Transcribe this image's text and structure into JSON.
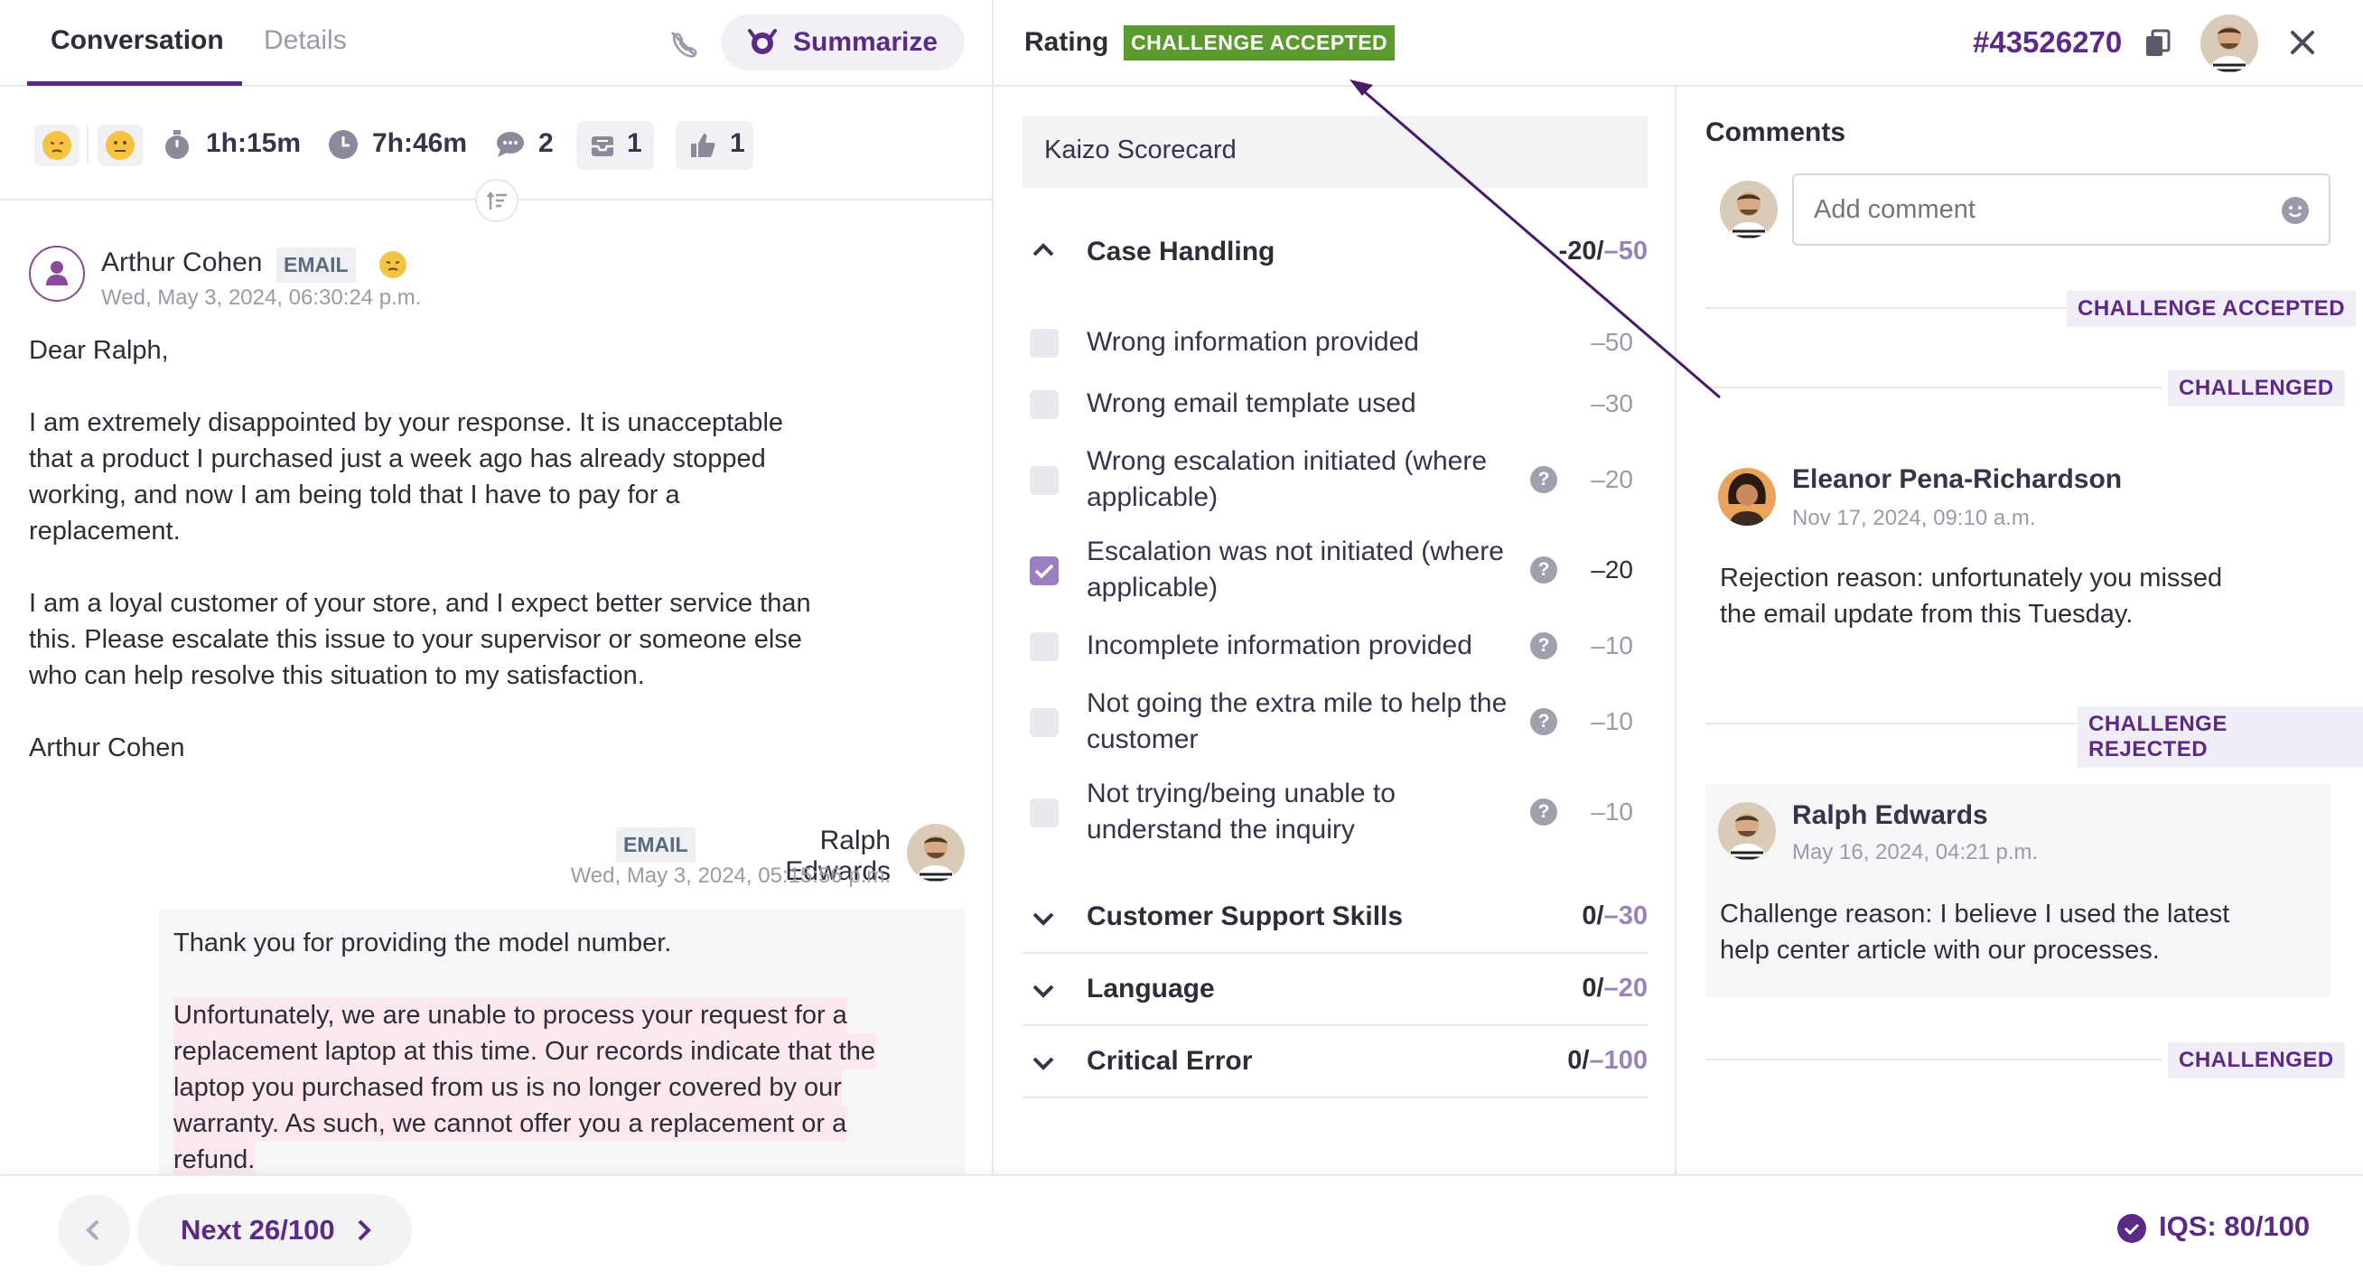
{
  "conversation": {
    "tabs": {
      "conversation": "Conversation",
      "details": "Details"
    },
    "summarize_label": "Summarize",
    "stats": {
      "handle_time": "1h:15m",
      "total_time": "7h:46m",
      "comments": "2",
      "tickets": "1",
      "likes": "1"
    },
    "message1": {
      "author": "Arthur Cohen",
      "channel": "EMAIL",
      "time": "Wed, May 3, 2024, 06:30:24 p.m.",
      "lines": [
        "Dear Ralph,",
        "I am extremely disappointed by your response. It is unacceptable",
        "that a product I purchased just a week ago has already stopped",
        "working, and now I am being told that I have to pay for a",
        "replacement.",
        "I am a loyal customer of your store, and I expect better service than",
        "this. Please escalate this issue to your supervisor or someone else",
        "who can help resolve this situation to my satisfaction.",
        "Arthur Cohen"
      ]
    },
    "message2": {
      "author": "Ralph Edwards",
      "channel": "EMAIL",
      "time": "Wed, May 3, 2024, 05:15:56 p.m.",
      "line1": "Thank you for providing the model number.",
      "highlight": [
        "Unfortunately, we are unable to process your request for a",
        "replacement laptop at this time. Our records indicate that the",
        "laptop you purchased from us is no longer covered by our",
        "warranty. As such, we cannot offer you a replacement or a",
        "refund."
      ]
    }
  },
  "footer": {
    "next_label": "Next 26/100",
    "iqs": "IQS: 80/100"
  },
  "rating": {
    "title": "Rating",
    "status_badge": "CHALLENGE ACCEPTED",
    "scorecard": "Kaizo Scorecard",
    "case_handling": {
      "name": "Case Handling",
      "score": "-20/",
      "max": "–50",
      "items": [
        {
          "lines": [
            "Wrong information provided"
          ],
          "points": "–50",
          "checked": false,
          "help": false
        },
        {
          "lines": [
            "Wrong email template used"
          ],
          "points": "–30",
          "checked": false,
          "help": false
        },
        {
          "lines": [
            "Wrong escalation initiated (where",
            "applicable)"
          ],
          "points": "–20",
          "checked": false,
          "help": true
        },
        {
          "lines": [
            "Escalation was not initiated (where",
            "applicable)"
          ],
          "points": "–20",
          "checked": true,
          "help": true
        },
        {
          "lines": [
            "Incomplete information provided"
          ],
          "points": "–10",
          "checked": false,
          "help": true
        },
        {
          "lines": [
            "Not going the extra mile to help the",
            "customer"
          ],
          "points": "–10",
          "checked": false,
          "help": true
        },
        {
          "lines": [
            "Not trying/being unable to",
            "understand the inquiry"
          ],
          "points": "–10",
          "checked": false,
          "help": true
        }
      ]
    },
    "sections": [
      {
        "name": "Customer Support Skills",
        "score": "0/",
        "max": "–30"
      },
      {
        "name": "Language",
        "score": "0/",
        "max": "–20"
      },
      {
        "name": "Critical Error",
        "score": "0/",
        "max": "–100"
      }
    ]
  },
  "header": {
    "ticket_id": "#43526270"
  },
  "comments": {
    "title": "Comments",
    "placeholder": "Add comment",
    "events": {
      "challenge_accepted": "CHALLENGE ACCEPTED",
      "challenged_1": "CHALLENGED",
      "challenge_rejected": "CHALLENGE REJECTED",
      "challenged_2": "CHALLENGED"
    },
    "comment1": {
      "author": "Eleanor Pena-Richardson",
      "time": "Nov 17, 2024, 09:10 a.m.",
      "lines": [
        "Rejection reason: unfortunately you missed",
        "the email update from this Tuesday."
      ]
    },
    "comment2": {
      "author": "Ralph Edwards",
      "time": "May 16, 2024, 04:21 p.m.",
      "lines": [
        "Challenge reason: I believe I used the latest",
        "help center article with our processes."
      ]
    }
  },
  "colors": {
    "brand": "#5b2a86",
    "accent_green": "#5a9a2f",
    "highlight": "#fde8ee"
  }
}
